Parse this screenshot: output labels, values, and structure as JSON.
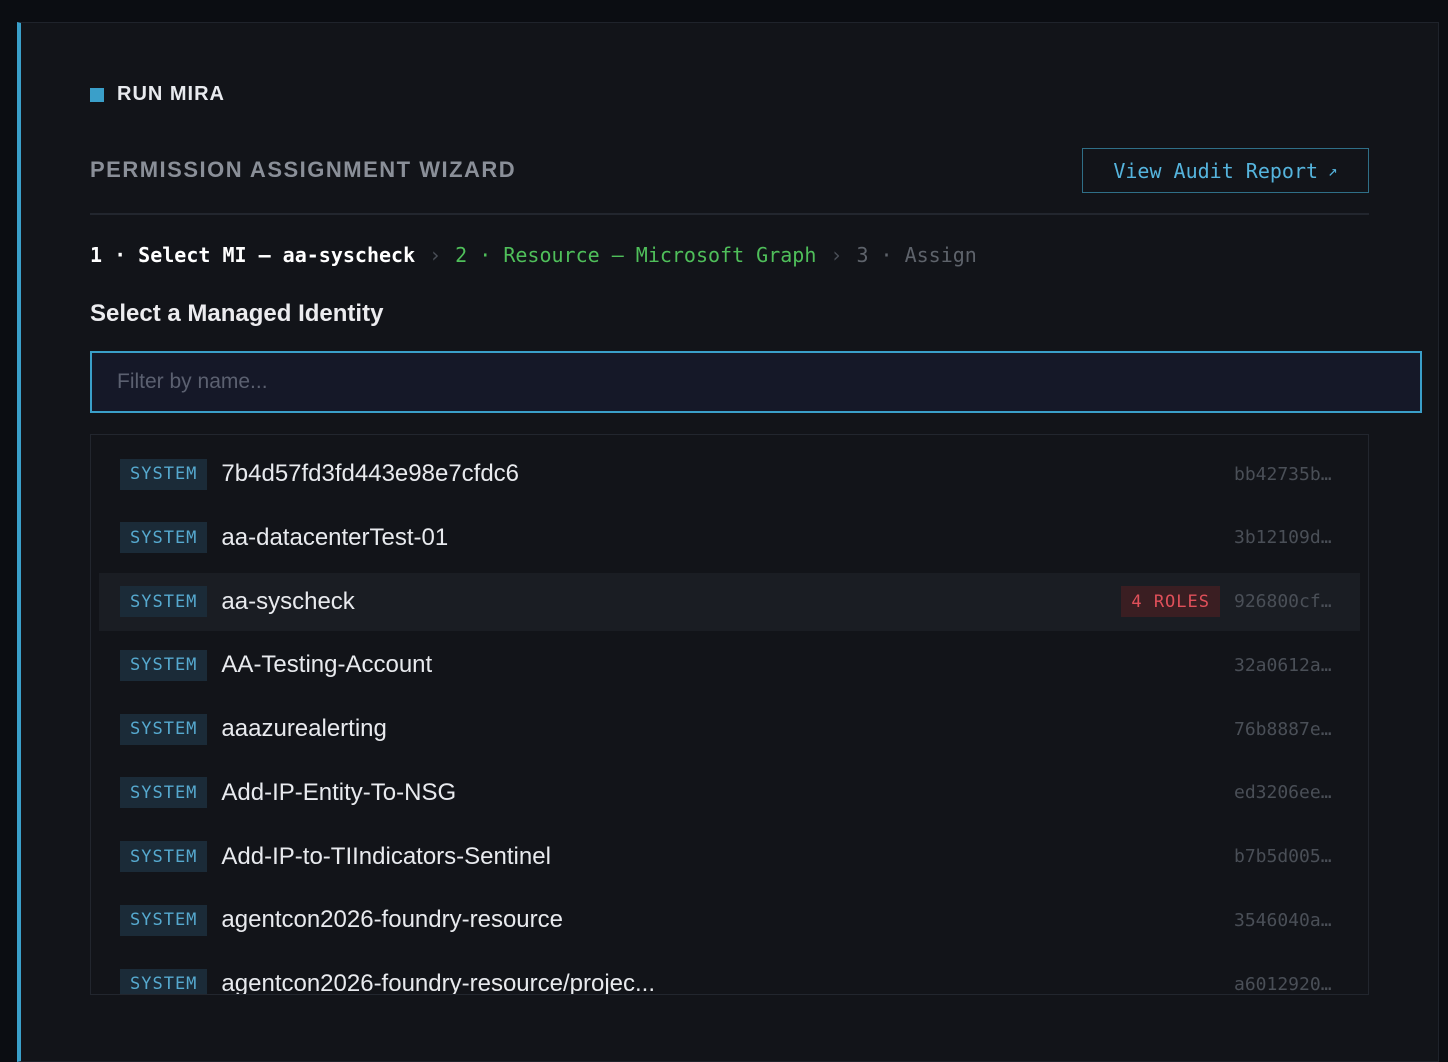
{
  "header": {
    "run_title": "RUN MIRA"
  },
  "wizard": {
    "title": "PERMISSION ASSIGNMENT WIZARD",
    "audit_button": "View Audit Report",
    "audit_icon": "external-link-icon"
  },
  "steps": [
    {
      "label": "1 · Select MI — aa-syscheck",
      "state": "active"
    },
    {
      "label": "2 · Resource — Microsoft Graph",
      "state": "done"
    },
    {
      "label": "3 · Assign",
      "state": "pending"
    }
  ],
  "step_separator": "›",
  "section": {
    "title": "Select a Managed Identity"
  },
  "filter": {
    "placeholder": "Filter by name...",
    "value": ""
  },
  "identities": [
    {
      "type": "SYSTEM",
      "name": "7b4d57fd3fd443e98e7cfdc6",
      "roles": "",
      "id": "bb42735b…"
    },
    {
      "type": "SYSTEM",
      "name": "aa-datacenterTest-01",
      "roles": "",
      "id": "3b12109d…"
    },
    {
      "type": "SYSTEM",
      "name": "aa-syscheck",
      "roles": "4 ROLES",
      "id": "926800cf…",
      "selected": true
    },
    {
      "type": "SYSTEM",
      "name": "AA-Testing-Account",
      "roles": "",
      "id": "32a0612a…"
    },
    {
      "type": "SYSTEM",
      "name": "aaazurealerting",
      "roles": "",
      "id": "76b8887e…"
    },
    {
      "type": "SYSTEM",
      "name": "Add-IP-Entity-To-NSG",
      "roles": "",
      "id": "ed3206ee…"
    },
    {
      "type": "SYSTEM",
      "name": "Add-IP-to-TIIndicators-Sentinel",
      "roles": "",
      "id": "b7b5d005…"
    },
    {
      "type": "SYSTEM",
      "name": "agentcon2026-foundry-resource",
      "roles": "",
      "id": "3546040a…"
    },
    {
      "type": "SYSTEM",
      "name": "agentcon2026-foundry-resource/projec...",
      "roles": "",
      "id": "a6012920…"
    }
  ],
  "colors": {
    "accent": "#3a9fc9",
    "done": "#4fbf5a",
    "roles": "#e0505a"
  }
}
